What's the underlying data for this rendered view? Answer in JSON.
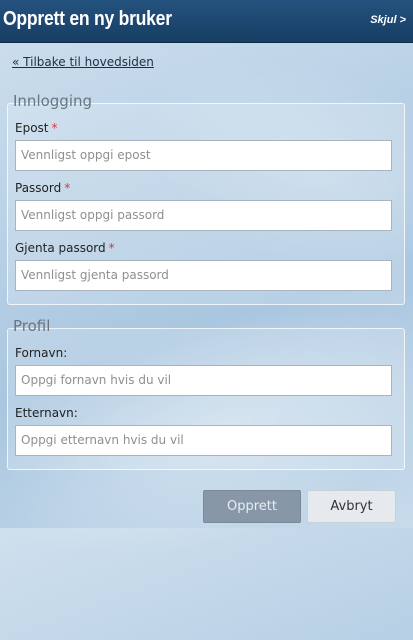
{
  "header": {
    "title": "Opprett en ny bruker",
    "hide_label": "Skjul >"
  },
  "back_link": "« Tilbake til hovedsiden",
  "login_section": {
    "legend": "Innlogging",
    "email": {
      "label": "Epost",
      "required_mark": "*",
      "placeholder": "Vennligst oppgi epost"
    },
    "password": {
      "label": "Passord",
      "required_mark": "*",
      "placeholder": "Vennligst oppgi passord"
    },
    "password_repeat": {
      "label": "Gjenta passord",
      "required_mark": "*",
      "placeholder": "Vennligst gjenta passord"
    }
  },
  "profile_section": {
    "legend": "Profil",
    "first_name": {
      "label": "Fornavn:",
      "placeholder": "Oppgi fornavn hvis du vil"
    },
    "last_name": {
      "label": "Etternavn:",
      "placeholder": "Oppgi etternavn hvis du vil"
    }
  },
  "buttons": {
    "create": "Opprett",
    "cancel": "Avbryt"
  },
  "colors": {
    "header_bg": "#1f4b74",
    "required": "#d03a3a",
    "create_button": "#8797a8",
    "cancel_button": "#e6eaee"
  }
}
